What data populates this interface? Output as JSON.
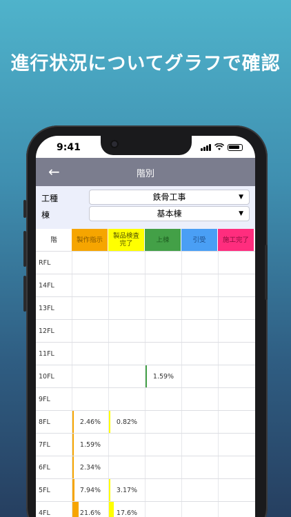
{
  "headline": "進行状況についてグラフで確認",
  "status": {
    "time": "9:41"
  },
  "nav": {
    "back_icon": "←",
    "title": "階別"
  },
  "filters": {
    "trade_label": "工種",
    "trade_value": "鉄骨工事",
    "building_label": "棟",
    "building_value": "基本棟",
    "caret": "▼"
  },
  "columns": {
    "floor_header": "階",
    "items": [
      {
        "label": "製作指示",
        "color": "#f6a500",
        "text_color": "#8a5a00"
      },
      {
        "label": "製品検査\n完了",
        "color": "#ffff00",
        "text_color": "#555500"
      },
      {
        "label": "上棟",
        "color": "#43a047",
        "text_color": "#1f5f22"
      },
      {
        "label": "引受",
        "color": "#4a9ff5",
        "text_color": "#1d4e8a"
      },
      {
        "label": "施工完了",
        "color": "#ff2d7e",
        "text_color": "#8a0d3d"
      }
    ]
  },
  "rows": [
    {
      "floor": "RFL",
      "values": [
        null,
        null,
        null,
        null,
        null
      ]
    },
    {
      "floor": "14FL",
      "values": [
        null,
        null,
        null,
        null,
        null
      ]
    },
    {
      "floor": "13FL",
      "values": [
        null,
        null,
        null,
        null,
        null
      ]
    },
    {
      "floor": "12FL",
      "values": [
        null,
        null,
        null,
        null,
        null
      ]
    },
    {
      "floor": "11FL",
      "values": [
        null,
        null,
        null,
        null,
        null
      ]
    },
    {
      "floor": "10FL",
      "values": [
        null,
        null,
        "1.59%",
        null,
        null
      ]
    },
    {
      "floor": "9FL",
      "values": [
        null,
        null,
        null,
        null,
        null
      ]
    },
    {
      "floor": "8FL",
      "values": [
        "2.46%",
        "0.82%",
        null,
        null,
        null
      ]
    },
    {
      "floor": "7FL",
      "values": [
        "1.59%",
        null,
        null,
        null,
        null
      ]
    },
    {
      "floor": "6FL",
      "values": [
        "2.34%",
        null,
        null,
        null,
        null
      ]
    },
    {
      "floor": "5FL",
      "values": [
        "7.94%",
        "3.17%",
        null,
        null,
        null
      ]
    },
    {
      "floor": "4FL",
      "values": [
        "21.6%",
        "17.6%",
        null,
        null,
        null
      ]
    }
  ],
  "progress_fraction": [
    [
      0,
      0,
      0,
      0,
      0
    ],
    [
      0,
      0,
      0,
      0,
      0
    ],
    [
      0,
      0,
      0,
      0,
      0
    ],
    [
      0,
      0,
      0,
      0,
      0
    ],
    [
      0,
      0,
      0,
      0,
      0
    ],
    [
      0,
      0,
      0.0159,
      0,
      0
    ],
    [
      0,
      0,
      0,
      0,
      0
    ],
    [
      0.0246,
      0.0082,
      0,
      0,
      0
    ],
    [
      0.0159,
      0,
      0,
      0,
      0
    ],
    [
      0.0234,
      0,
      0,
      0,
      0
    ],
    [
      0.0794,
      0.0317,
      0,
      0,
      0
    ],
    [
      0.216,
      0.176,
      0,
      0,
      0
    ]
  ]
}
